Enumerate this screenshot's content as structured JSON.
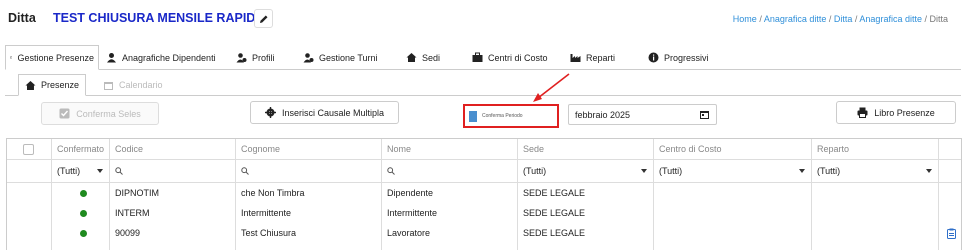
{
  "header": {
    "label": "Ditta",
    "company_name": "TEST CHIUSURA MENSILE RAPIDA",
    "breadcrumb": {
      "home": "Home",
      "sep": " / ",
      "item1": "Anagrafica ditte",
      "item2": "Ditta",
      "item3": "Anagrafica ditte",
      "current": "Ditta"
    }
  },
  "main_tabs": [
    {
      "label": "Gestione Presenze",
      "icon": "calendar-icon"
    },
    {
      "label": "Anagrafiche Dipendenti",
      "icon": "user-icon"
    },
    {
      "label": "Profili",
      "icon": "user-cog-icon"
    },
    {
      "label": "Gestione Turni",
      "icon": "user-clock-icon"
    },
    {
      "label": "Sedi",
      "icon": "home-icon"
    },
    {
      "label": "Centri di Costo",
      "icon": "briefcase-icon"
    },
    {
      "label": "Reparti",
      "icon": "industry-icon"
    },
    {
      "label": "Progressivi",
      "icon": "info-icon"
    }
  ],
  "sub_tabs": [
    {
      "label": "Presenze",
      "icon": "house-icon",
      "active": true
    },
    {
      "label": "Calendario",
      "icon": "calendar-icon",
      "active": false
    }
  ],
  "toolbar": {
    "conferma_seles": "Conferma Seles",
    "inserisci_causale": "Inserisci Causale Multipla",
    "conferma_periodo": "Conferma Periodo",
    "month": "febbraio 2025",
    "libro_presenze": "Libro Presenze"
  },
  "table": {
    "columns": [
      "Confermato",
      "Codice",
      "Cognome",
      "Nome",
      "Sede",
      "Centro di Costo",
      "Reparto"
    ],
    "filters": {
      "confermato": "(Tutti)",
      "sede": "(Tutti)",
      "centro": "(Tutti)",
      "reparto": "(Tutti)"
    },
    "rows": [
      {
        "codice": "DIPNOTIM",
        "cognome": "che Non Timbra",
        "nome": "Dipendente",
        "sede": "SEDE LEGALE"
      },
      {
        "codice": "INTERM",
        "cognome": "Intermittente",
        "nome": "Intermittente",
        "sede": "SEDE LEGALE"
      },
      {
        "codice": "90099",
        "cognome": "Test Chiusura",
        "nome": "Lavoratore",
        "sede": "SEDE LEGALE"
      }
    ]
  },
  "colors": {
    "brand": "#1a28c8",
    "link": "#2f8fd9",
    "confirmed": "#1e8a1e",
    "annotation": "#e02020"
  }
}
